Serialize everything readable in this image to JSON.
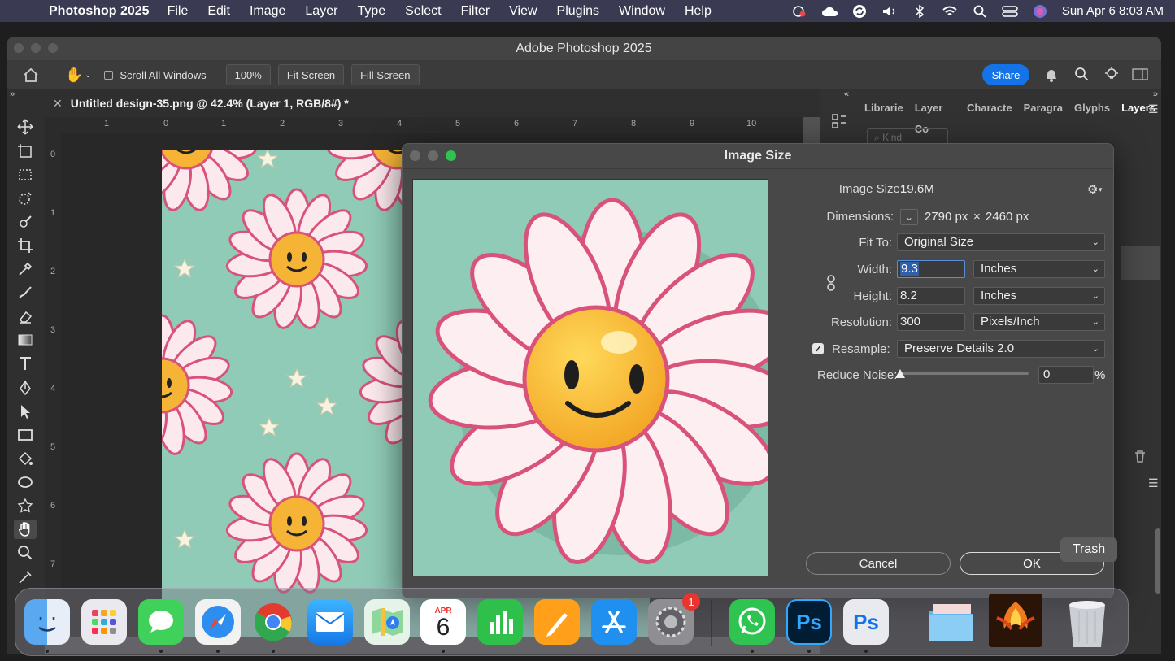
{
  "menubar": {
    "app": "Photoshop 2025",
    "items": [
      "File",
      "Edit",
      "Image",
      "Layer",
      "Type",
      "Select",
      "Filter",
      "View",
      "Plugins",
      "Window",
      "Help"
    ],
    "clock": "Sun Apr 6  8:03 AM"
  },
  "window": {
    "title": "Adobe Photoshop 2025"
  },
  "options": {
    "scroll_all": "Scroll All Windows",
    "zoom": "100%",
    "fit_screen": "Fit Screen",
    "fill_screen": "Fill Screen",
    "share": "Share"
  },
  "document": {
    "tab_title": "Untitled design-35.png @ 42.4% (Layer 1, RGB/8#) *"
  },
  "ruler": {
    "h": [
      "1",
      "0",
      "1",
      "2",
      "3",
      "4",
      "5",
      "6",
      "7",
      "8",
      "9",
      "10"
    ],
    "v": [
      "0",
      "1",
      "2",
      "3",
      "4",
      "5",
      "6",
      "7"
    ]
  },
  "panels": {
    "tabs": [
      "Librarie",
      "Layer Co",
      "Characte",
      "Paragra",
      "Glyphs",
      "Layers"
    ],
    "kind_placeholder": "Kind"
  },
  "dialog": {
    "title": "Image Size",
    "image_size_label": "Image Size:",
    "image_size_value": "19.6M",
    "dimensions_label": "Dimensions:",
    "dim_w": "2790 px",
    "dim_x": "×",
    "dim_h": "2460 px",
    "fit_to_label": "Fit To:",
    "fit_to_value": "Original Size",
    "width_label": "Width:",
    "width_value": "9.3",
    "width_unit": "Inches",
    "height_label": "Height:",
    "height_value": "8.2",
    "height_unit": "Inches",
    "resolution_label": "Resolution:",
    "resolution_value": "300",
    "resolution_unit": "Pixels/Inch",
    "resample_label": "Resample:",
    "resample_checked": true,
    "resample_value": "Preserve Details 2.0",
    "reduce_noise_label": "Reduce Noise:",
    "reduce_noise_value": "0",
    "reduce_noise_unit": "%",
    "cancel": "Cancel",
    "ok": "OK"
  },
  "dock": {
    "calendar_month": "APR",
    "calendar_day": "6",
    "settings_badge": "1",
    "ps_label": "Ps",
    "tooltip": "Trash"
  }
}
